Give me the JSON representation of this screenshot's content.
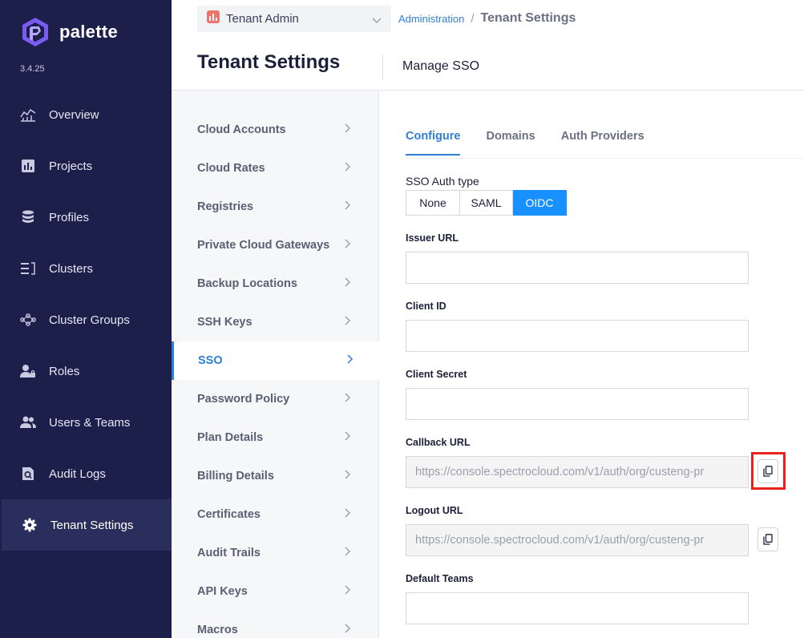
{
  "app": {
    "name": "palette",
    "version": "3.4.25"
  },
  "nav": [
    {
      "label": "Overview",
      "icon": "overview-chart-icon"
    },
    {
      "label": "Projects",
      "icon": "projects-icon"
    },
    {
      "label": "Profiles",
      "icon": "profiles-stack-icon"
    },
    {
      "label": "Clusters",
      "icon": "clusters-icon"
    },
    {
      "label": "Cluster Groups",
      "icon": "cluster-groups-icon"
    },
    {
      "label": "Roles",
      "icon": "roles-icon"
    },
    {
      "label": "Users & Teams",
      "icon": "users-icon"
    },
    {
      "label": "Audit Logs",
      "icon": "audit-logs-icon"
    },
    {
      "label": "Tenant Settings",
      "icon": "gear-icon",
      "active": true
    }
  ],
  "header": {
    "scope": "Tenant Admin",
    "breadcrumb_link": "Administration",
    "breadcrumb_separator": "/",
    "breadcrumb_current": "Tenant Settings",
    "title": "Tenant Settings",
    "subtitle": "Manage SSO"
  },
  "settings_menu": [
    {
      "label": "Cloud Accounts"
    },
    {
      "label": "Cloud Rates"
    },
    {
      "label": "Registries"
    },
    {
      "label": "Private Cloud Gateways"
    },
    {
      "label": "Backup Locations"
    },
    {
      "label": "SSH Keys"
    },
    {
      "label": "SSO",
      "active": true
    },
    {
      "label": "Password Policy"
    },
    {
      "label": "Plan Details"
    },
    {
      "label": "Billing Details"
    },
    {
      "label": "Certificates"
    },
    {
      "label": "Audit Trails"
    },
    {
      "label": "API Keys"
    },
    {
      "label": "Macros"
    }
  ],
  "tabs": [
    {
      "label": "Configure",
      "active": true
    },
    {
      "label": "Domains"
    },
    {
      "label": "Auth Providers"
    }
  ],
  "sso": {
    "auth_type_label": "SSO Auth type",
    "auth_types": [
      "None",
      "SAML",
      "OIDC"
    ],
    "selected_auth_type": "OIDC"
  },
  "form": {
    "issuer_url": {
      "label": "Issuer URL",
      "value": ""
    },
    "client_id": {
      "label": "Client ID",
      "value": ""
    },
    "client_secret": {
      "label": "Client Secret",
      "value": ""
    },
    "callback_url": {
      "label": "Callback URL",
      "value": "https://console.spectrocloud.com/v1/auth/org/custeng-pr"
    },
    "logout_url": {
      "label": "Logout URL",
      "value": "https://console.spectrocloud.com/v1/auth/org/custeng-pr"
    },
    "default_teams": {
      "label": "Default Teams",
      "value": ""
    }
  },
  "colors": {
    "nav_bg": "#1c1f4a",
    "accent": "#2f7fd6",
    "selected": "#1890ff",
    "highlight": "#e8231c"
  }
}
